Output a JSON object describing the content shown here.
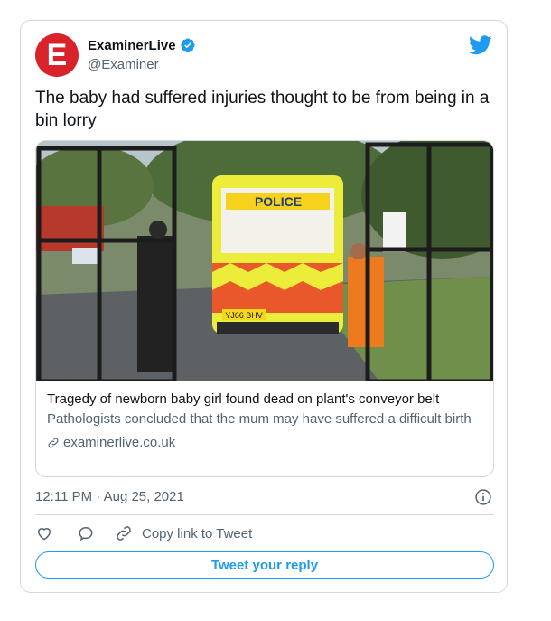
{
  "account": {
    "avatar_letter": "E",
    "display_name": "ExaminerLive",
    "handle": "@Examiner",
    "avatar_color": "#d8232a",
    "verified": true
  },
  "tweet": {
    "text": "The baby had suffered injuries thought to be from being in a bin lorry",
    "timestamp": "12:11 PM · Aug 25, 2021"
  },
  "link_card": {
    "image_description_icon": "police-van-photo",
    "van_label": "POLICE",
    "plate": "YJ66 BHV",
    "title": "Tragedy of newborn baby girl found dead on plant's conveyor belt",
    "description": "Pathologists concluded that the mum may have suffered a difficult birth",
    "domain": "examinerlive.co.uk"
  },
  "actions": {
    "copy_link_label": "Copy link to Tweet",
    "reply_button_label": "Tweet your reply"
  },
  "colors": {
    "accent": "#1d9bf0",
    "secondary_text": "#536471",
    "border": "#cfd9de"
  }
}
